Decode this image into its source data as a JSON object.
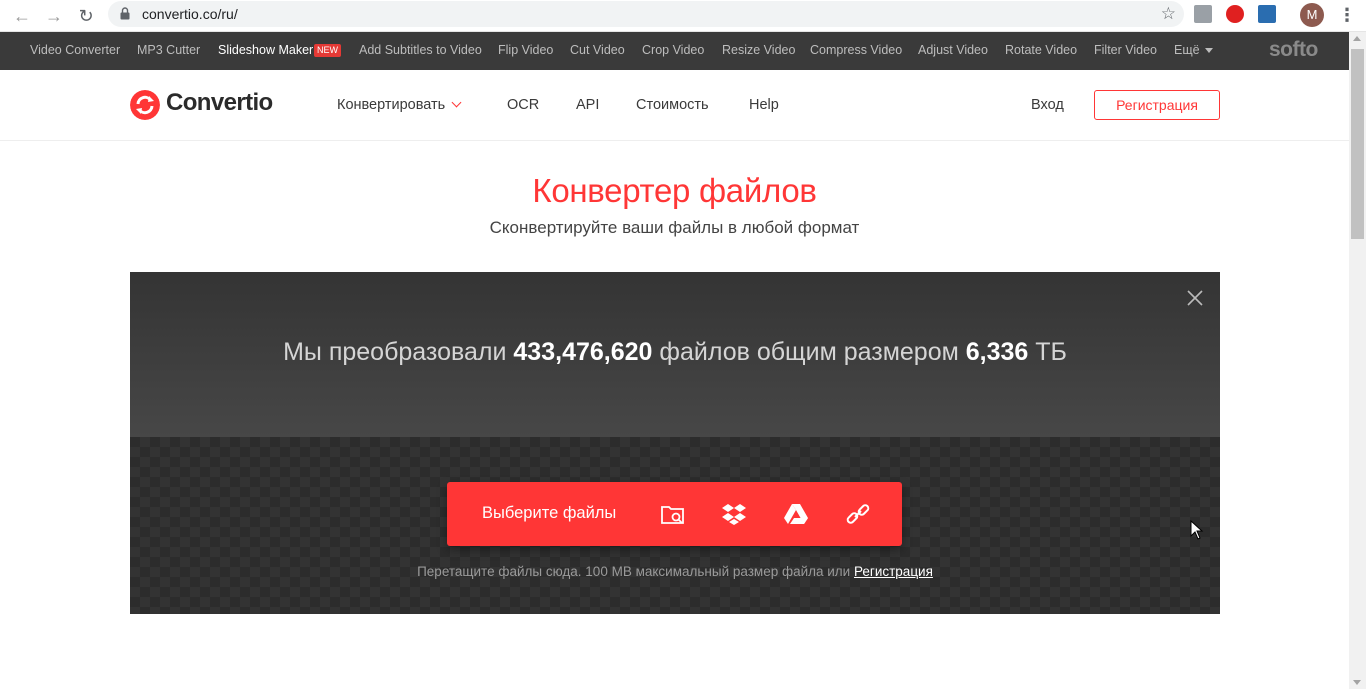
{
  "browser": {
    "url": "convertio.co/ru/",
    "avatar_letter": "M"
  },
  "softo_bar": {
    "items": [
      {
        "label": "Video Converter"
      },
      {
        "label": "MP3 Cutter"
      },
      {
        "label": "Slideshow Maker",
        "badge": "NEW"
      },
      {
        "label": "Add Subtitles to Video"
      },
      {
        "label": "Flip Video"
      },
      {
        "label": "Cut Video"
      },
      {
        "label": "Crop Video"
      },
      {
        "label": "Resize Video"
      },
      {
        "label": "Compress Video"
      },
      {
        "label": "Adjust Video"
      },
      {
        "label": "Rotate Video"
      },
      {
        "label": "Filter Video"
      }
    ],
    "more_label": "Ещё",
    "logo": "softo"
  },
  "header": {
    "logo": "Convertio",
    "nav": {
      "convert": "Конвертировать",
      "ocr": "OCR",
      "api": "API",
      "pricing": "Стоимость",
      "help": "Help"
    },
    "login": "Вход",
    "register": "Регистрация"
  },
  "hero": {
    "title": "Конвертер файлов",
    "subtitle": "Сконвертируйте ваши файлы в любой формат"
  },
  "stats": {
    "prefix": "Мы преобразовали ",
    "files_count": "433,476,620",
    "middle": " файлов общим размером ",
    "total_size": "6,336",
    "unit": " ТБ"
  },
  "upload": {
    "choose_label": "Выберите файлы",
    "icons": [
      "folder-search-icon",
      "dropbox-icon",
      "google-drive-icon",
      "link-icon"
    ],
    "hint_text": "Перетащите файлы сюда. 100 MB максимальный размер файла или ",
    "hint_link": "Регистрация"
  },
  "colors": {
    "accent": "#ff3636",
    "softo_bar": "#3a3a3a",
    "dark_panel": "#2c2c2c"
  }
}
